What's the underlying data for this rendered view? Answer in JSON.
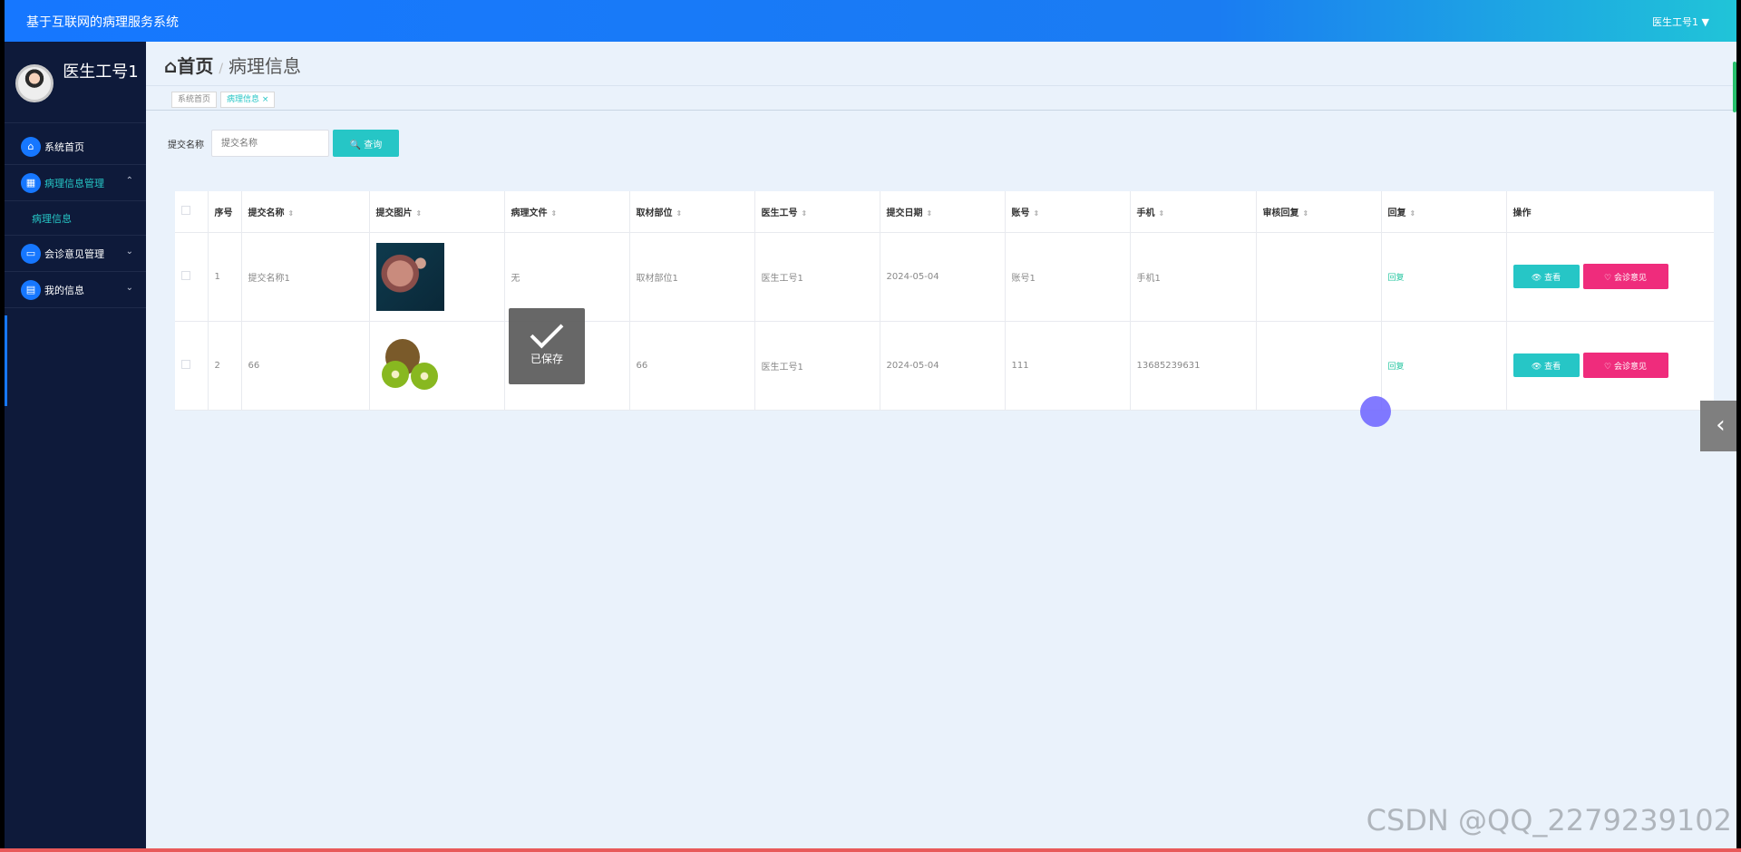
{
  "app": {
    "title": "基于互联网的病理服务系统",
    "user_menu": "医生工号1 ▼"
  },
  "sidebar": {
    "profile_name": "医生工号1",
    "items": [
      {
        "label": "系统首页",
        "icon": "home-icon",
        "chevron": ""
      },
      {
        "label": "病理信息管理",
        "icon": "grid-icon",
        "chevron": "⌃"
      },
      {
        "label": "会诊意见管理",
        "icon": "monitor-icon",
        "chevron": "⌄"
      },
      {
        "label": "我的信息",
        "icon": "card-icon",
        "chevron": "⌄"
      }
    ],
    "sub_item": "病理信息"
  },
  "breadcrumb": {
    "home": "⌂首页",
    "sep": "/",
    "current": "病理信息"
  },
  "tags": {
    "home": "系统首页",
    "current": "病理信息 ×"
  },
  "search": {
    "label": "提交名称",
    "placeholder": "提交名称",
    "button": "🔍 查询"
  },
  "table": {
    "headers": [
      "",
      "序号",
      "提交名称",
      "提交图片",
      "病理文件",
      "取材部位",
      "医生工号",
      "提交日期",
      "账号",
      "手机",
      "审核回复",
      "回复",
      "操作"
    ],
    "rows": [
      {
        "index": "1",
        "name": "提交名称1",
        "image": "bio",
        "file": "无",
        "site": "取材部位1",
        "doctor": "医生工号1",
        "date": "2024-05-04",
        "account": "账号1",
        "phone": "手机1",
        "review": "",
        "reply": "回复"
      },
      {
        "index": "2",
        "name": "66",
        "image": "kiwi",
        "file": "",
        "site": "66",
        "doctor": "医生工号1",
        "date": "2024-05-04",
        "account": "111",
        "phone": "13685239631",
        "review": "",
        "reply": "回复"
      }
    ],
    "view_btn": "👁 查看",
    "consult_btn": "♡ 会诊意见"
  },
  "toast": {
    "message": "已保存"
  },
  "watermark": "CSDN @QQ_2279239102"
}
